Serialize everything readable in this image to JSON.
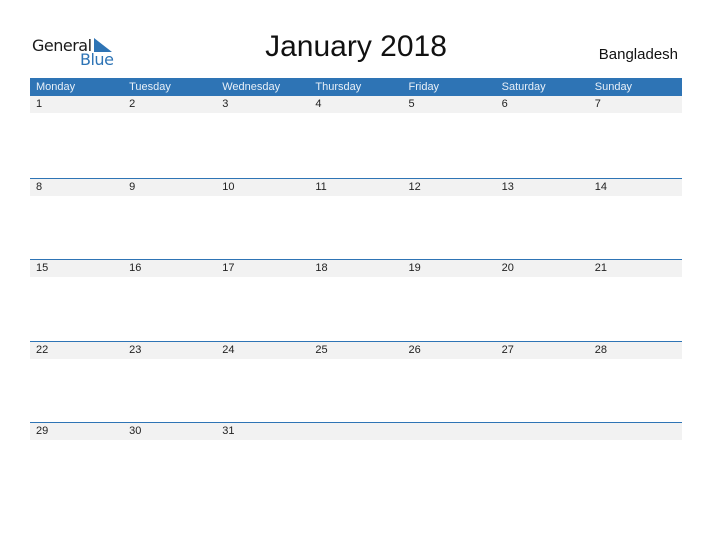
{
  "logo": {
    "word1": "General",
    "word2": "Blue"
  },
  "title": "January 2018",
  "country": "Bangladesh",
  "weekdays": [
    "Monday",
    "Tuesday",
    "Wednesday",
    "Thursday",
    "Friday",
    "Saturday",
    "Sunday"
  ],
  "weeks": [
    [
      "1",
      "2",
      "3",
      "4",
      "5",
      "6",
      "7"
    ],
    [
      "8",
      "9",
      "10",
      "11",
      "12",
      "13",
      "14"
    ],
    [
      "15",
      "16",
      "17",
      "18",
      "19",
      "20",
      "21"
    ],
    [
      "22",
      "23",
      "24",
      "25",
      "26",
      "27",
      "28"
    ],
    [
      "29",
      "30",
      "31",
      "",
      "",
      "",
      ""
    ]
  ],
  "colors": {
    "accent": "#2e74b5",
    "date_row_bg": "#f2f2f2"
  }
}
